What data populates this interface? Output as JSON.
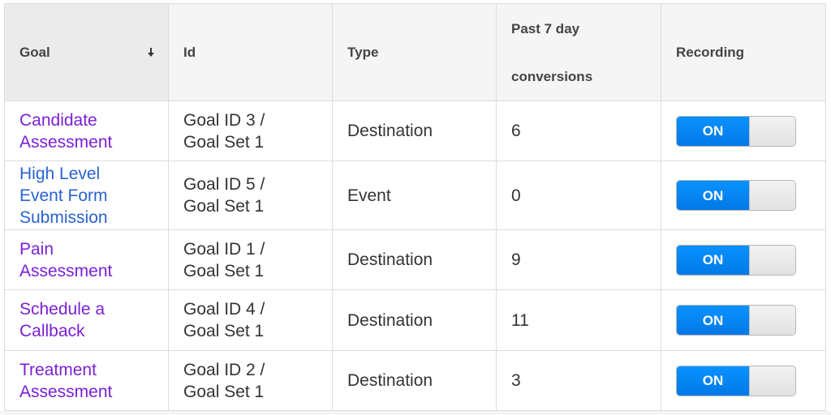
{
  "table": {
    "headers": {
      "goal": "Goal",
      "id": "Id",
      "type": "Type",
      "conversions_line1": "Past 7 day",
      "conversions_line2": "conversions",
      "recording": "Recording"
    },
    "sort": {
      "column": "goal",
      "icon": "arrow-down-icon"
    },
    "rows": [
      {
        "goal_line1": "Candidate",
        "goal_line2": "Assessment",
        "goal_line3": "",
        "visited": true,
        "id_line1": "Goal ID 3 /",
        "id_line2": "Goal Set 1",
        "type": "Destination",
        "conversions": "6",
        "recording": "ON"
      },
      {
        "goal_line1": "High Level",
        "goal_line2": "Event Form",
        "goal_line3": "Submission",
        "visited": false,
        "id_line1": "Goal ID 5 /",
        "id_line2": "Goal Set 1",
        "type": "Event",
        "conversions": "0",
        "recording": "ON"
      },
      {
        "goal_line1": "Pain",
        "goal_line2": "Assessment",
        "goal_line3": "",
        "visited": true,
        "id_line1": "Goal ID 1 /",
        "id_line2": "Goal Set 1",
        "type": "Destination",
        "conversions": "9",
        "recording": "ON"
      },
      {
        "goal_line1": "Schedule a",
        "goal_line2": "Callback",
        "goal_line3": "",
        "visited": true,
        "id_line1": "Goal ID 4 /",
        "id_line2": "Goal Set 1",
        "type": "Destination",
        "conversions": "11",
        "recording": "ON"
      },
      {
        "goal_line1": "Treatment",
        "goal_line2": "Assessment",
        "goal_line3": "",
        "visited": true,
        "id_line1": "Goal ID 2 /",
        "id_line2": "Goal Set 1",
        "type": "Destination",
        "conversions": "3",
        "recording": "ON"
      }
    ]
  },
  "colors": {
    "visited_link": "#7b1fd6",
    "unvisited_link": "#2a63d0",
    "toggle_on": "#0a8cf5",
    "header_bg": "#f5f5f5",
    "sorted_header_bg": "#ebebeb"
  }
}
